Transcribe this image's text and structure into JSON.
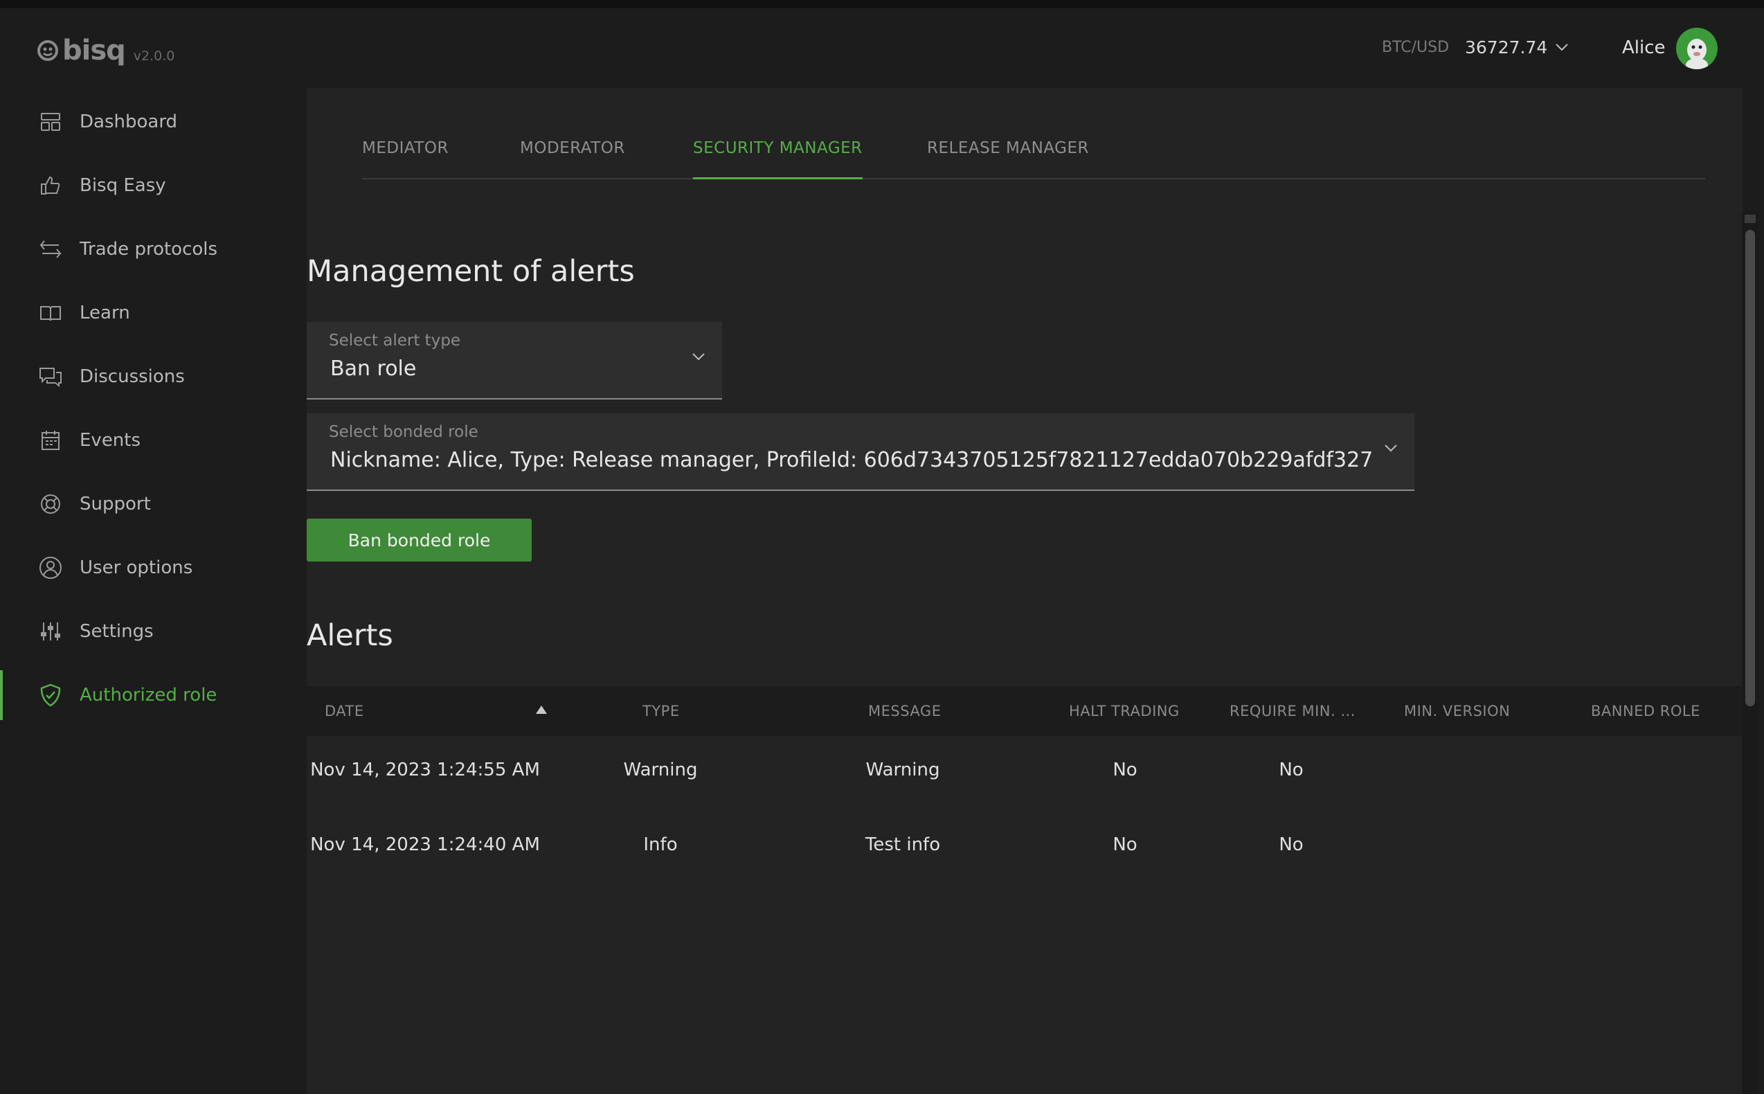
{
  "app": {
    "name": "bisq",
    "version": "v2.0.0"
  },
  "header": {
    "market_label": "BTC/USD",
    "price": "36727.74",
    "user_name": "Alice"
  },
  "sidebar": {
    "items": [
      {
        "label": "Dashboard",
        "icon": "dashboard-icon"
      },
      {
        "label": "Bisq Easy",
        "icon": "thumbs-up-icon"
      },
      {
        "label": "Trade protocols",
        "icon": "exchange-arrows-icon"
      },
      {
        "label": "Learn",
        "icon": "book-icon"
      },
      {
        "label": "Discussions",
        "icon": "chat-bubbles-icon"
      },
      {
        "label": "Events",
        "icon": "calendar-icon"
      },
      {
        "label": "Support",
        "icon": "lifebuoy-icon"
      },
      {
        "label": "User options",
        "icon": "user-icon"
      },
      {
        "label": "Settings",
        "icon": "sliders-icon"
      },
      {
        "label": "Authorized role",
        "icon": "shield-check-icon",
        "active": true
      }
    ]
  },
  "tabs": [
    {
      "label": "MEDIATOR"
    },
    {
      "label": "MODERATOR"
    },
    {
      "label": "SECURITY MANAGER",
      "active": true
    },
    {
      "label": "RELEASE MANAGER"
    }
  ],
  "management": {
    "title": "Management of alerts",
    "alert_type": {
      "label": "Select alert type",
      "value": "Ban role"
    },
    "bonded_role": {
      "label": "Select bonded role",
      "value": "Nickname: Alice, Type: Release manager, ProfileId: 606d7343705125f7821127edda070b229afdf327"
    },
    "ban_button": "Ban bonded role"
  },
  "alerts": {
    "title": "Alerts",
    "columns": [
      "DATE",
      "TYPE",
      "MESSAGE",
      "HALT TRADING",
      "REQUIRE MIN. ...",
      "MIN. VERSION",
      "BANNED ROLE"
    ],
    "sorted_column": "DATE",
    "sort_direction": "ascending",
    "rows": [
      {
        "date": "Nov 14, 2023 1:24:55 AM",
        "type": "Warning",
        "message": "Warning",
        "halt_trading": "No",
        "require_min": "No",
        "min_version": "",
        "banned_role": ""
      },
      {
        "date": "Nov 14, 2023 1:24:40 AM",
        "type": "Info",
        "message": "Test info",
        "halt_trading": "No",
        "require_min": "No",
        "min_version": "",
        "banned_role": ""
      }
    ]
  },
  "colors": {
    "accent": "#56ae48",
    "button": "#3f8a38",
    "background": "#1c1c1c",
    "panel": "#232323"
  }
}
